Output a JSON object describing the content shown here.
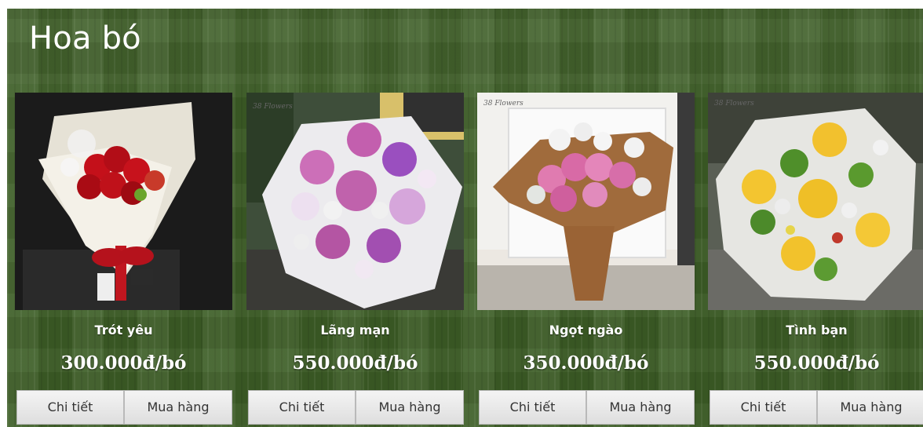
{
  "section": {
    "title": "Hoa bó"
  },
  "products": [
    {
      "name": "Trót yêu",
      "price": "300.000đ/bó",
      "detail_label": "Chi tiết",
      "buy_label": "Mua hàng",
      "image_icon": "red-rose-bouquet-image"
    },
    {
      "name": "Lãng mạn",
      "price": "550.000đ/bó",
      "detail_label": "Chi tiết",
      "buy_label": "Mua hàng",
      "image_icon": "purple-rose-bouquet-image"
    },
    {
      "name": "Ngọt ngào",
      "price": "350.000đ/bó",
      "detail_label": "Chi tiết",
      "buy_label": "Mua hàng",
      "image_icon": "pink-rose-bouquet-image"
    },
    {
      "name": "Tình bạn",
      "price": "550.000đ/bó",
      "detail_label": "Chi tiết",
      "buy_label": "Mua hàng",
      "image_icon": "yellow-rose-bouquet-image"
    }
  ],
  "colors": {
    "section_background": "#3d5e26",
    "button_background": "#e9e9e9",
    "button_text": "#333333",
    "text": "#ffffff"
  }
}
